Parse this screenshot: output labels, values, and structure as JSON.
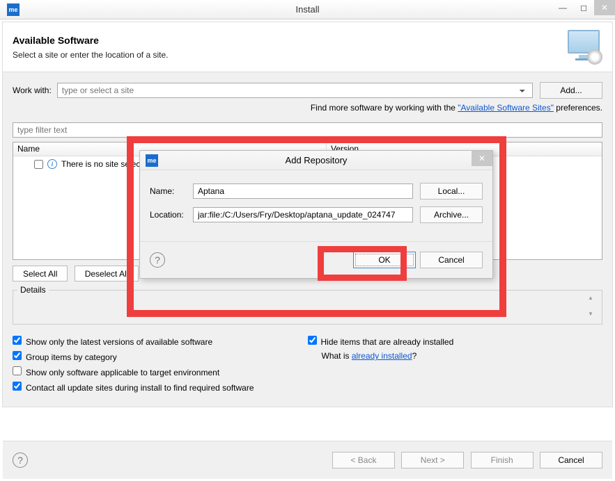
{
  "window": {
    "title": "Install",
    "app_icon_text": "me"
  },
  "header": {
    "heading": "Available Software",
    "subheading": "Select a site or enter the location of a site."
  },
  "work_with": {
    "label": "Work with:",
    "placeholder": "type or select a site",
    "add_label": "Add..."
  },
  "find_more": {
    "prefix": "Find more software by working with the ",
    "link": "\"Available Software Sites\"",
    "suffix": " preferences."
  },
  "filter": {
    "placeholder": "type filter text"
  },
  "tree": {
    "col_name": "Name",
    "col_version": "Version",
    "no_site": "There is no site selected."
  },
  "buttons": {
    "select_all": "Select All",
    "deselect_all": "Deselect All"
  },
  "details": {
    "label": "Details"
  },
  "checks": {
    "latest": "Show only the latest versions of available software",
    "group": "Group items by category",
    "target_env": "Show only software applicable to target environment",
    "contact_sites": "Contact all update sites during install to find required software",
    "hide_installed": "Hide items that are already installed",
    "what_is_prefix": "What is ",
    "what_is_link": "already installed",
    "what_is_suffix": "?"
  },
  "footer": {
    "back": "< Back",
    "next": "Next >",
    "finish": "Finish",
    "cancel": "Cancel"
  },
  "dialog": {
    "title": "Add Repository",
    "name_label": "Name:",
    "name_value": "Aptana",
    "location_label": "Location:",
    "location_value": "jar:file:/C:/Users/Fry/Desktop/aptana_update_024747",
    "local": "Local...",
    "archive": "Archive...",
    "ok": "OK",
    "cancel": "Cancel"
  }
}
